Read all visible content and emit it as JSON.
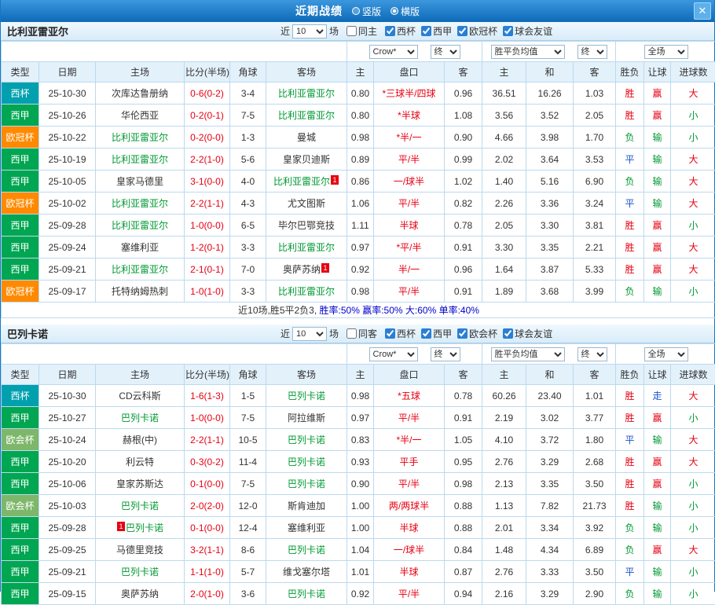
{
  "window": {
    "title": "近期战绩",
    "radios": [
      {
        "label": "竖版",
        "checked": false
      },
      {
        "label": "横版",
        "checked": true
      }
    ],
    "close_label": "✕"
  },
  "colors": {
    "topbar_blue": "#1278c8",
    "red": "#e60012",
    "green": "#009933",
    "blue": "#1a56cc",
    "type_badges": {
      "西杯": "#00a0ae",
      "西甲": "#00a651",
      "欧冠杯": "#ff8a00",
      "欧会杯": "#7eb76a"
    }
  },
  "value_colors": {
    "胜": "red",
    "平": "blue",
    "负": "green",
    "赢": "red",
    "走": "blue",
    "输": "green",
    "大": "red",
    "小": "green"
  },
  "table_headers": [
    "类型",
    "日期",
    "主场",
    "比分(半场)",
    "角球",
    "客场",
    "主",
    "盘口",
    "客",
    "主",
    "和",
    "客",
    "胜负",
    "让球",
    "进球数"
  ],
  "sections": [
    {
      "team": "比利亚雷亚尔",
      "near_label": "近",
      "games_count": "10",
      "games_label": "场",
      "same_filter": {
        "label": "同主",
        "checked": false
      },
      "filters": [
        {
          "label": "西杯",
          "checked": true
        },
        {
          "label": "西甲",
          "checked": true
        },
        {
          "label": "欧冠杯",
          "checked": true
        },
        {
          "label": "球会友谊",
          "checked": true
        }
      ],
      "dropdowns": {
        "bookmaker": "Crow*",
        "ah_final": "终",
        "avg": "胜平负均值",
        "eu_final": "终",
        "scope": "全场"
      },
      "rows": [
        {
          "type": "西杯",
          "date": "25-10-30",
          "home": {
            "name": "次库达鲁册纳"
          },
          "score": "0-6(0-2)",
          "corners": "3-4",
          "away": {
            "name": "比利亚雷亚尔",
            "green": true
          },
          "ah": [
            "0.80",
            "*三球半/四球",
            "0.96"
          ],
          "eu": [
            "36.51",
            "16.26",
            "1.03"
          ],
          "results": [
            "胜",
            "赢",
            "大"
          ]
        },
        {
          "type": "西甲",
          "date": "25-10-26",
          "home": {
            "name": "华伦西亚"
          },
          "score": "0-2(0-1)",
          "corners": "7-5",
          "away": {
            "name": "比利亚雷亚尔",
            "green": true
          },
          "ah": [
            "0.80",
            "*半球",
            "1.08"
          ],
          "eu": [
            "3.56",
            "3.52",
            "2.05"
          ],
          "results": [
            "胜",
            "赢",
            "小"
          ]
        },
        {
          "type": "欧冠杯",
          "date": "25-10-22",
          "home": {
            "name": "比利亚雷亚尔",
            "green": true
          },
          "score": "0-2(0-0)",
          "corners": "1-3",
          "away": {
            "name": "曼城"
          },
          "ah": [
            "0.98",
            "*半/一",
            "0.90"
          ],
          "eu": [
            "4.66",
            "3.98",
            "1.70"
          ],
          "results": [
            "负",
            "输",
            "小"
          ]
        },
        {
          "type": "西甲",
          "date": "25-10-19",
          "home": {
            "name": "比利亚雷亚尔",
            "green": true
          },
          "score": "2-2(1-0)",
          "corners": "5-6",
          "away": {
            "name": "皇家贝迪斯"
          },
          "ah": [
            "0.89",
            "平/半",
            "0.99"
          ],
          "eu": [
            "2.02",
            "3.64",
            "3.53"
          ],
          "results": [
            "平",
            "输",
            "大"
          ]
        },
        {
          "type": "西甲",
          "date": "25-10-05",
          "home": {
            "name": "皇家马德里"
          },
          "score": "3-1(0-0)",
          "corners": "4-0",
          "away": {
            "name": "比利亚雷亚尔",
            "green": true,
            "badge": "1",
            "badge_pos": "after"
          },
          "ah": [
            "0.86",
            "一/球半",
            "1.02"
          ],
          "eu": [
            "1.40",
            "5.16",
            "6.90"
          ],
          "results": [
            "负",
            "输",
            "大"
          ]
        },
        {
          "type": "欧冠杯",
          "date": "25-10-02",
          "home": {
            "name": "比利亚雷亚尔",
            "green": true
          },
          "score": "2-2(1-1)",
          "corners": "4-3",
          "away": {
            "name": "尤文图斯"
          },
          "ah": [
            "1.06",
            "平/半",
            "0.82"
          ],
          "eu": [
            "2.26",
            "3.36",
            "3.24"
          ],
          "results": [
            "平",
            "输",
            "大"
          ]
        },
        {
          "type": "西甲",
          "date": "25-09-28",
          "home": {
            "name": "比利亚雷亚尔",
            "green": true
          },
          "score": "1-0(0-0)",
          "corners": "6-5",
          "away": {
            "name": "毕尔巴鄂竞技"
          },
          "ah": [
            "1.11",
            "半球",
            "0.78"
          ],
          "eu": [
            "2.05",
            "3.30",
            "3.81"
          ],
          "results": [
            "胜",
            "赢",
            "小"
          ]
        },
        {
          "type": "西甲",
          "date": "25-09-24",
          "home": {
            "name": "塞维利亚"
          },
          "score": "1-2(0-1)",
          "corners": "3-3",
          "away": {
            "name": "比利亚雷亚尔",
            "green": true
          },
          "ah": [
            "0.97",
            "*平/半",
            "0.91"
          ],
          "eu": [
            "3.30",
            "3.35",
            "2.21"
          ],
          "results": [
            "胜",
            "赢",
            "大"
          ]
        },
        {
          "type": "西甲",
          "date": "25-09-21",
          "home": {
            "name": "比利亚雷亚尔",
            "green": true
          },
          "score": "2-1(0-1)",
          "corners": "7-0",
          "away": {
            "name": "奥萨苏纳",
            "badge": "1",
            "badge_pos": "after"
          },
          "ah": [
            "0.92",
            "半/一",
            "0.96"
          ],
          "eu": [
            "1.64",
            "3.87",
            "5.33"
          ],
          "results": [
            "胜",
            "赢",
            "大"
          ]
        },
        {
          "type": "欧冠杯",
          "date": "25-09-17",
          "home": {
            "name": "托特纳姆热刺"
          },
          "score": "1-0(1-0)",
          "corners": "3-3",
          "away": {
            "name": "比利亚雷亚尔",
            "green": true
          },
          "ah": [
            "0.98",
            "平/半",
            "0.91"
          ],
          "eu": [
            "1.89",
            "3.68",
            "3.99"
          ],
          "results": [
            "负",
            "输",
            "小"
          ]
        }
      ],
      "summary": [
        {
          "text": "近10场,胜5平2负3, ",
          "color": "dark"
        },
        {
          "text": "胜率:50% ",
          "color": "blue"
        },
        {
          "text": "赢率:50% ",
          "color": "blue"
        },
        {
          "text": "大:60% ",
          "color": "blue"
        },
        {
          "text": "单率:40%",
          "color": "blue"
        }
      ]
    },
    {
      "team": "巴列卡诺",
      "near_label": "近",
      "games_count": "10",
      "games_label": "场",
      "same_filter": {
        "label": "同客",
        "checked": false
      },
      "filters": [
        {
          "label": "西杯",
          "checked": true
        },
        {
          "label": "西甲",
          "checked": true
        },
        {
          "label": "欧会杯",
          "checked": true
        },
        {
          "label": "球会友谊",
          "checked": true
        }
      ],
      "dropdowns": {
        "bookmaker": "Crow*",
        "ah_final": "终",
        "avg": "胜平负均值",
        "eu_final": "终",
        "scope": "全场"
      },
      "rows": [
        {
          "type": "西杯",
          "date": "25-10-30",
          "home": {
            "name": "CD云科斯"
          },
          "score": "1-6(1-3)",
          "corners": "1-5",
          "away": {
            "name": "巴列卡诺",
            "green": true
          },
          "ah": [
            "0.98",
            "*五球",
            "0.78"
          ],
          "eu": [
            "60.26",
            "23.40",
            "1.01"
          ],
          "results": [
            "胜",
            "走",
            "大"
          ]
        },
        {
          "type": "西甲",
          "date": "25-10-27",
          "home": {
            "name": "巴列卡诺",
            "green": true
          },
          "score": "1-0(0-0)",
          "corners": "7-5",
          "away": {
            "name": "阿拉维斯"
          },
          "ah": [
            "0.97",
            "平/半",
            "0.91"
          ],
          "eu": [
            "2.19",
            "3.02",
            "3.77"
          ],
          "results": [
            "胜",
            "赢",
            "小"
          ]
        },
        {
          "type": "欧会杯",
          "date": "25-10-24",
          "home": {
            "name": "赫根(中)"
          },
          "score": "2-2(1-1)",
          "corners": "10-5",
          "away": {
            "name": "巴列卡诺",
            "green": true
          },
          "ah": [
            "0.83",
            "*半/一",
            "1.05"
          ],
          "eu": [
            "4.10",
            "3.72",
            "1.80"
          ],
          "results": [
            "平",
            "输",
            "大"
          ]
        },
        {
          "type": "西甲",
          "date": "25-10-20",
          "home": {
            "name": "利云特"
          },
          "score": "0-3(0-2)",
          "corners": "11-4",
          "away": {
            "name": "巴列卡诺",
            "green": true
          },
          "ah": [
            "0.93",
            "平手",
            "0.95"
          ],
          "eu": [
            "2.76",
            "3.29",
            "2.68"
          ],
          "results": [
            "胜",
            "赢",
            "大"
          ]
        },
        {
          "type": "西甲",
          "date": "25-10-06",
          "home": {
            "name": "皇家苏斯达"
          },
          "score": "0-1(0-0)",
          "corners": "7-5",
          "away": {
            "name": "巴列卡诺",
            "green": true
          },
          "ah": [
            "0.90",
            "平/半",
            "0.98"
          ],
          "eu": [
            "2.13",
            "3.35",
            "3.50"
          ],
          "results": [
            "胜",
            "赢",
            "小"
          ]
        },
        {
          "type": "欧会杯",
          "date": "25-10-03",
          "home": {
            "name": "巴列卡诺",
            "green": true
          },
          "score": "2-0(2-0)",
          "corners": "12-0",
          "away": {
            "name": "斯肯迪加"
          },
          "ah": [
            "1.00",
            "两/两球半",
            "0.88"
          ],
          "eu": [
            "1.13",
            "7.82",
            "21.73"
          ],
          "results": [
            "胜",
            "输",
            "小"
          ]
        },
        {
          "type": "西甲",
          "date": "25-09-28",
          "home": {
            "name": "巴列卡诺",
            "green": true,
            "badge": "1",
            "badge_pos": "before"
          },
          "score": "0-1(0-0)",
          "corners": "12-4",
          "away": {
            "name": "塞维利亚"
          },
          "ah": [
            "1.00",
            "半球",
            "0.88"
          ],
          "eu": [
            "2.01",
            "3.34",
            "3.92"
          ],
          "results": [
            "负",
            "输",
            "小"
          ]
        },
        {
          "type": "西甲",
          "date": "25-09-25",
          "home": {
            "name": "马德里竞技"
          },
          "score": "3-2(1-1)",
          "corners": "8-6",
          "away": {
            "name": "巴列卡诺",
            "green": true
          },
          "ah": [
            "1.04",
            "一/球半",
            "0.84"
          ],
          "eu": [
            "1.48",
            "4.34",
            "6.89"
          ],
          "results": [
            "负",
            "赢",
            "大"
          ]
        },
        {
          "type": "西甲",
          "date": "25-09-21",
          "home": {
            "name": "巴列卡诺",
            "green": true
          },
          "score": "1-1(1-0)",
          "corners": "5-7",
          "away": {
            "name": "维戈塞尔塔"
          },
          "ah": [
            "1.01",
            "半球",
            "0.87"
          ],
          "eu": [
            "2.76",
            "3.33",
            "3.50"
          ],
          "results": [
            "平",
            "输",
            "小"
          ]
        },
        {
          "type": "西甲",
          "date": "25-09-15",
          "home": {
            "name": "奥萨苏纳"
          },
          "score": "2-0(1-0)",
          "corners": "3-6",
          "away": {
            "name": "巴列卡诺",
            "green": true
          },
          "ah": [
            "0.92",
            "平/半",
            "0.94"
          ],
          "eu": [
            "2.16",
            "3.29",
            "2.90"
          ],
          "results": [
            "负",
            "输",
            "小"
          ]
        }
      ]
    }
  ]
}
